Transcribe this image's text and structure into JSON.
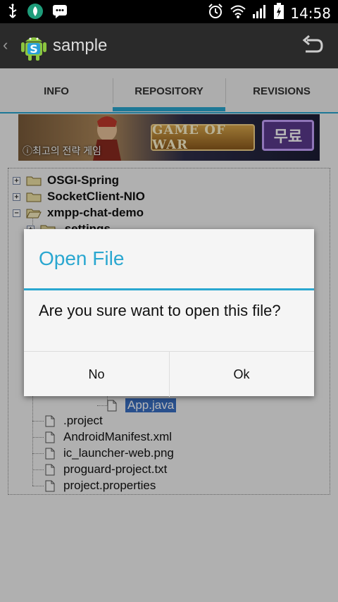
{
  "status_bar": {
    "time": "14:58",
    "icons": [
      "usb-icon",
      "app-notification-icon",
      "message-icon",
      "alarm-icon",
      "wifi-icon",
      "signal-icon",
      "battery-charging-icon"
    ]
  },
  "action_bar": {
    "title": "sample",
    "back_icon": "chevron-left-icon",
    "undo_icon": "undo-icon"
  },
  "tabs": [
    {
      "label": "INFO"
    },
    {
      "label": "REPOSITORY"
    },
    {
      "label": "REVISIONS"
    }
  ],
  "active_tab": "REPOSITORY",
  "ad": {
    "game_label": "GAME OF WAR",
    "free_label": "무료",
    "tagline": "ⓘ최고의 전략 게임"
  },
  "tree": {
    "nodes": [
      {
        "label": "OSGI-Spring",
        "type": "folder",
        "expander": "+"
      },
      {
        "label": "SocketClient-NIO",
        "type": "folder",
        "expander": "+"
      },
      {
        "label": "xmpp-chat-demo",
        "type": "folder",
        "expander": "−"
      },
      {
        "label": ".settings",
        "type": "folder",
        "expander": "+"
      }
    ],
    "selected_file": "App.java",
    "files": [
      {
        "label": ".project"
      },
      {
        "label": "AndroidManifest.xml"
      },
      {
        "label": "ic_launcher-web.png"
      },
      {
        "label": "proguard-project.txt"
      },
      {
        "label": "project.properties"
      }
    ]
  },
  "dialog": {
    "title": "Open File",
    "message": "Are you sure want to open this file?",
    "negative_label": "No",
    "positive_label": "Ok"
  },
  "colors": {
    "accent": "#2aa7d0",
    "action_bar": "#2a2a2a",
    "selection": "#3a6fc4"
  }
}
